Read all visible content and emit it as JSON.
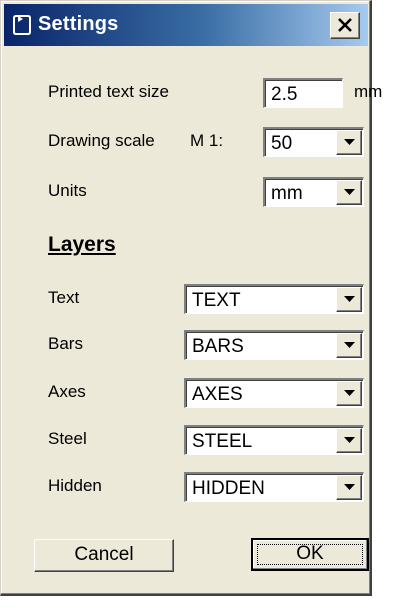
{
  "window": {
    "title": "Settings",
    "close_label": "×"
  },
  "settings": {
    "text_size_label": "Printed text size",
    "text_size_value": "2.5",
    "text_size_unit": "mm",
    "scale_label": "Drawing scale",
    "scale_prefix": "M 1:",
    "scale_value": "50",
    "units_label": "Units",
    "units_value": "mm"
  },
  "layers": {
    "heading": "Layers",
    "items": [
      {
        "label": "Text",
        "value": "TEXT"
      },
      {
        "label": "Bars",
        "value": "BARS"
      },
      {
        "label": "Axes",
        "value": "AXES"
      },
      {
        "label": "Steel",
        "value": "STEEL"
      },
      {
        "label": "Hidden",
        "value": "HIDDEN"
      }
    ]
  },
  "buttons": {
    "cancel": "Cancel",
    "ok": "OK"
  },
  "icons": {
    "title": "window-icon",
    "dropdown": "chevron-down-icon"
  }
}
